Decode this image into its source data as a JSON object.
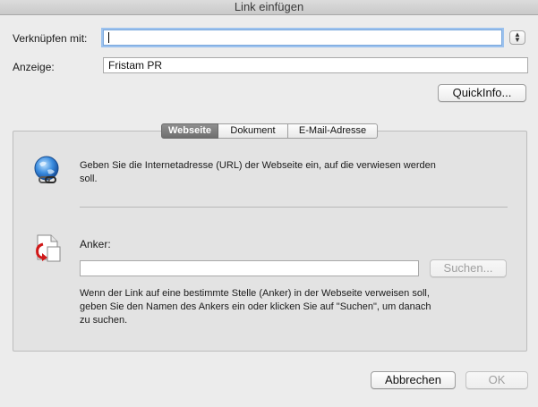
{
  "window": {
    "title": "Link einfügen"
  },
  "form": {
    "link_label": "Verknüpfen mit:",
    "link_value": "",
    "display_label": "Anzeige:",
    "display_value": "Fristam PR",
    "quickinfo_button": "QuickInfo..."
  },
  "tabs": [
    {
      "label": "Webseite",
      "active": true
    },
    {
      "label": "Dokument",
      "active": false
    },
    {
      "label": "E-Mail-Adresse",
      "active": false
    }
  ],
  "webpage": {
    "instruction": "Geben Sie die Internetadresse (URL) der Webseite ein, auf die verwiesen werden soll.",
    "anchor_label": "Anker:",
    "anchor_value": "",
    "search_button": "Suchen...",
    "anchor_help": "Wenn der Link auf eine bestimmte Stelle (Anker) in der Webseite verweisen soll, geben Sie den Namen des Ankers ein oder klicken Sie auf \"Suchen\", um danach zu suchen."
  },
  "footer": {
    "cancel_button": "Abbrechen",
    "ok_button": "OK"
  },
  "icons": {
    "globe": "globe-link-icon",
    "anchor": "anchor-document-icon",
    "stepper": "stepper-icon"
  },
  "colors": {
    "focus_ring": "#9cc2ee",
    "active_tab": "#7a7a7a",
    "window_bg": "#ececec"
  }
}
